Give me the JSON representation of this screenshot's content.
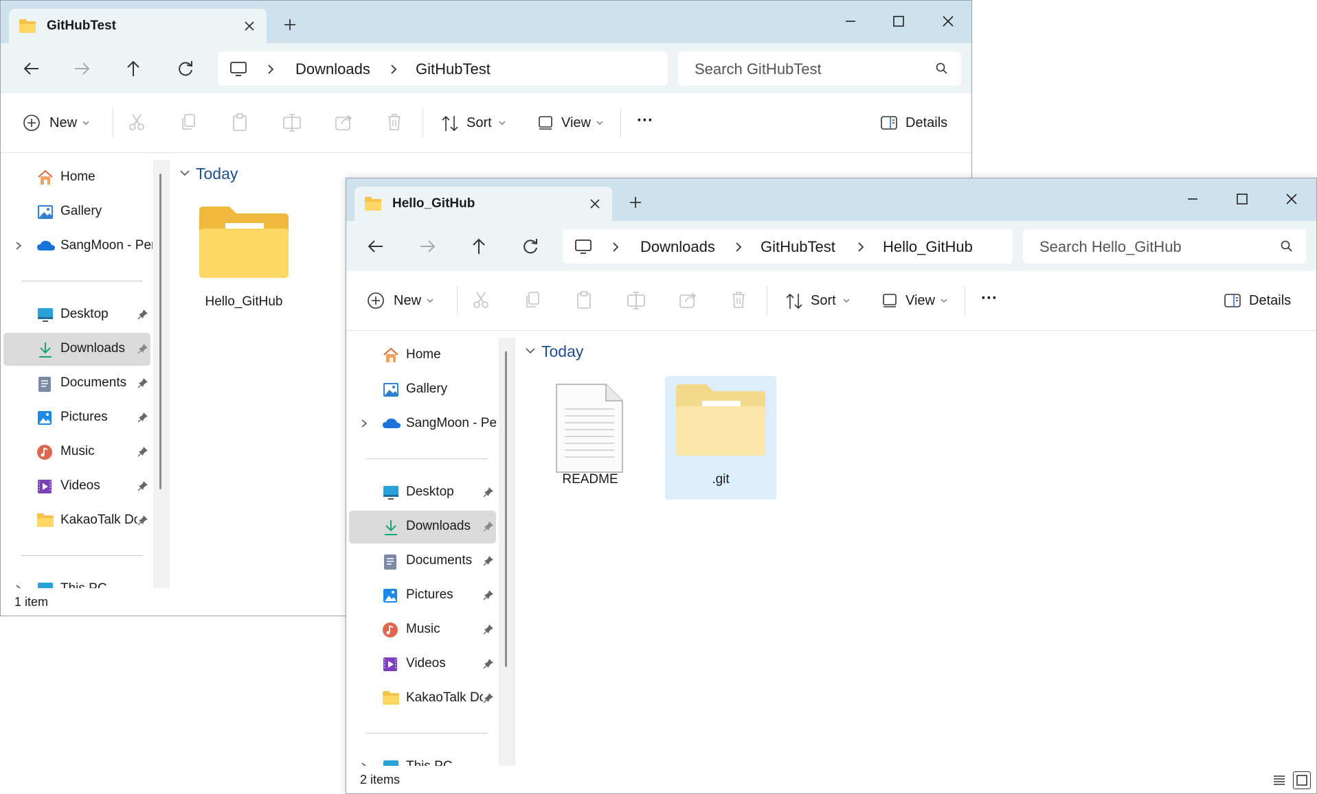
{
  "colors": {
    "titlebar": "#cde2ec",
    "navbar": "#eef3f6",
    "accent": "#1f4e8c",
    "selection": "#dceefb",
    "folder": "#f6c24a"
  },
  "back_window": {
    "tab_title": "GitHubTest",
    "breadcrumb": [
      "Downloads",
      "GitHubTest"
    ],
    "search_placeholder": "Search GitHubTest",
    "commands": {
      "new": "New",
      "sort": "Sort",
      "view": "View",
      "more": "···",
      "details": "Details"
    },
    "sidebar": [
      {
        "label": "Home",
        "icon": "home-icon"
      },
      {
        "label": "Gallery",
        "icon": "gallery-icon"
      },
      {
        "label": "SangMoon - Per",
        "icon": "onedrive-icon",
        "expandable": true
      },
      {
        "label": "Desktop",
        "icon": "desktop-icon",
        "pinned": true
      },
      {
        "label": "Downloads",
        "icon": "download-icon",
        "pinned": true,
        "selected": true
      },
      {
        "label": "Documents",
        "icon": "documents-icon",
        "pinned": true
      },
      {
        "label": "Pictures",
        "icon": "pictures-icon",
        "pinned": true
      },
      {
        "label": "Music",
        "icon": "music-icon",
        "pinned": true
      },
      {
        "label": "Videos",
        "icon": "videos-icon",
        "pinned": true
      },
      {
        "label": "KakaoTalk Dc",
        "icon": "folder-icon",
        "pinned": true
      },
      {
        "label": "This PC",
        "icon": "this-pc-icon",
        "expandable": true
      }
    ],
    "group_header": "Today",
    "items": [
      {
        "name": "Hello_GitHub",
        "type": "folder"
      }
    ],
    "status": "1 item"
  },
  "front_window": {
    "tab_title": "Hello_GitHub",
    "breadcrumb": [
      "Downloads",
      "GitHubTest",
      "Hello_GitHub"
    ],
    "search_placeholder": "Search Hello_GitHub",
    "commands": {
      "new": "New",
      "sort": "Sort",
      "view": "View",
      "more": "···",
      "details": "Details"
    },
    "sidebar": [
      {
        "label": "Home",
        "icon": "home-icon"
      },
      {
        "label": "Gallery",
        "icon": "gallery-icon"
      },
      {
        "label": "SangMoon - Per",
        "icon": "onedrive-icon",
        "expandable": true
      },
      {
        "label": "Desktop",
        "icon": "desktop-icon",
        "pinned": true
      },
      {
        "label": "Downloads",
        "icon": "download-icon",
        "pinned": true,
        "selected": true
      },
      {
        "label": "Documents",
        "icon": "documents-icon",
        "pinned": true
      },
      {
        "label": "Pictures",
        "icon": "pictures-icon",
        "pinned": true
      },
      {
        "label": "Music",
        "icon": "music-icon",
        "pinned": true
      },
      {
        "label": "Videos",
        "icon": "videos-icon",
        "pinned": true
      },
      {
        "label": "KakaoTalk Dc",
        "icon": "folder-icon",
        "pinned": true
      },
      {
        "label": "This PC",
        "icon": "this-pc-icon",
        "expandable": true
      }
    ],
    "group_header": "Today",
    "items": [
      {
        "name": "README",
        "type": "file"
      },
      {
        "name": ".git",
        "type": "folder",
        "hidden": true,
        "selected": true
      }
    ],
    "status": "2 items"
  }
}
